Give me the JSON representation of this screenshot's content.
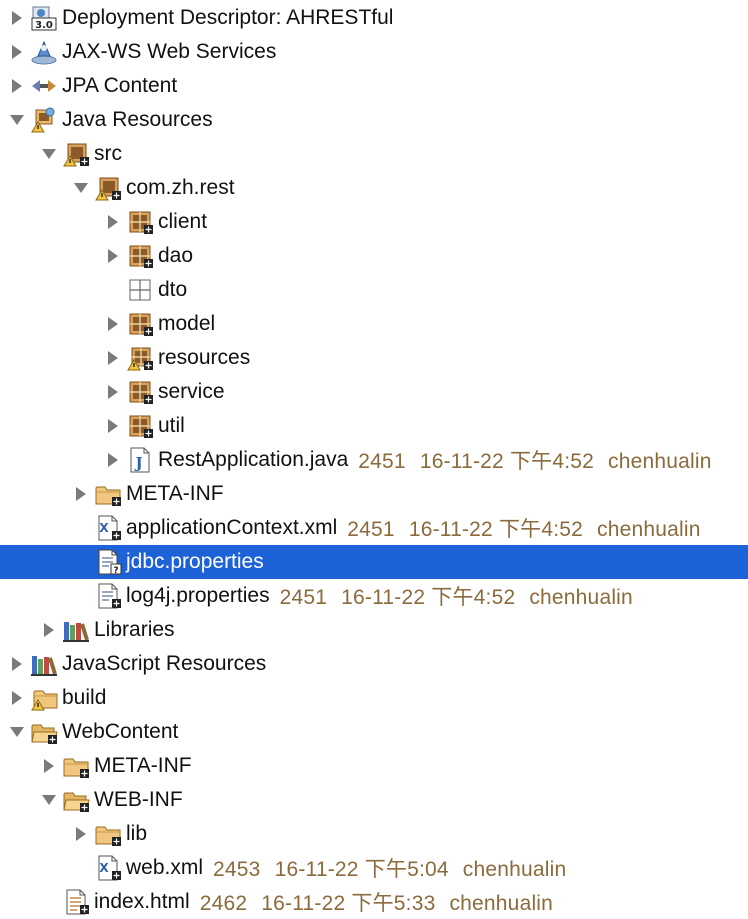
{
  "tree": {
    "deployment_descriptor": {
      "label": "Deployment Descriptor: AHRESTful",
      "badge": "3.0"
    },
    "jaxws": {
      "label": "JAX-WS Web Services"
    },
    "jpa": {
      "label": "JPA Content"
    },
    "java_resources": {
      "label": "Java Resources"
    },
    "src": {
      "label": "src"
    },
    "package_root": {
      "label": "com.zh.rest"
    },
    "pkg_client": {
      "label": "client"
    },
    "pkg_dao": {
      "label": "dao"
    },
    "pkg_dto": {
      "label": "dto"
    },
    "pkg_model": {
      "label": "model"
    },
    "pkg_resources": {
      "label": "resources"
    },
    "pkg_service": {
      "label": "service"
    },
    "pkg_util": {
      "label": "util"
    },
    "rest_application": {
      "label": "RestApplication.java",
      "revision": "2451",
      "date": "16-11-22 下午4:52",
      "author": "chenhualin"
    },
    "src_meta_inf": {
      "label": "META-INF"
    },
    "application_context": {
      "label": "applicationContext.xml",
      "revision": "2451",
      "date": "16-11-22 下午4:52",
      "author": "chenhualin"
    },
    "jdbc_properties": {
      "label": "jdbc.properties"
    },
    "log4j_properties": {
      "label": "log4j.properties",
      "revision": "2451",
      "date": "16-11-22 下午4:52",
      "author": "chenhualin"
    },
    "libraries": {
      "label": "Libraries"
    },
    "js_resources": {
      "label": "JavaScript Resources"
    },
    "build": {
      "label": "build"
    },
    "webcontent": {
      "label": "WebContent"
    },
    "wc_meta_inf": {
      "label": "META-INF"
    },
    "web_inf": {
      "label": "WEB-INF"
    },
    "lib": {
      "label": "lib"
    },
    "web_xml": {
      "label": "web.xml",
      "revision": "2453",
      "date": "16-11-22 下午5:04",
      "author": "chenhualin"
    },
    "index_html": {
      "label": "index.html",
      "revision": "2462",
      "date": "16-11-22 下午5:33",
      "author": "chenhualin"
    }
  },
  "colors": {
    "selection": "#1d62d6",
    "metadata_text": "#8b6a3c",
    "package_brown": "#8a5a2b",
    "folder_tan": "#e9b96a"
  },
  "selected_item": "jdbc.properties"
}
